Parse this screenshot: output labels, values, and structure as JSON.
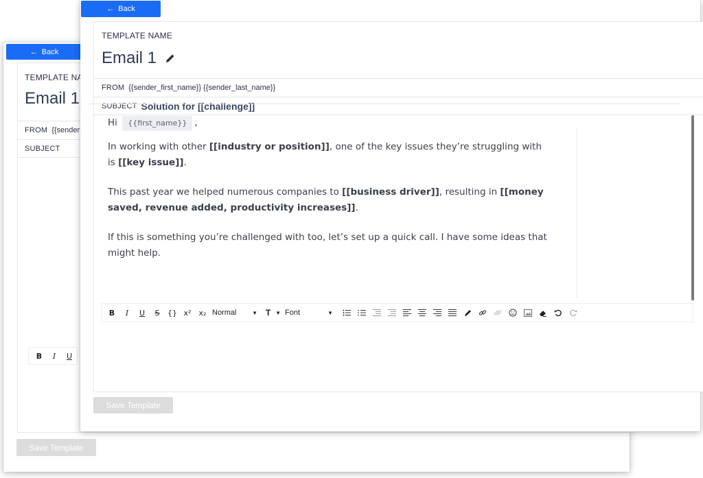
{
  "back_label": "Back",
  "template_name_label": "TEMPLATE NAME",
  "template_name": "Email 1",
  "from_label": "FROM",
  "from_value": "{{sender_first_name}} {{sender_last_name}}",
  "subject_label": "SUBJECT",
  "subject_value": "Solution for [[challenge]]",
  "back_window": {
    "template_name_label": "TEMPLATE NA",
    "template_name": "Email 1",
    "from_value": "{{sender"
  },
  "body": {
    "greeting_hi": "Hi",
    "greeting_token": "{{first_name}}",
    "greeting_comma": ",",
    "p1_a": "In working with other ",
    "p1_b": "[[industry or position]]",
    "p1_c": ", one of the key issues they’re struggling with is ",
    "p1_d": "[[key issue]]",
    "p1_e": ".",
    "p2_a": "This past year we helped numerous companies to ",
    "p2_b": "[[business driver]]",
    "p2_c": ", resulting in ",
    "p2_d": "[[money saved, revenue added, productivity increases]]",
    "p2_e": ".",
    "p3": "If this is something you’re challenged with too, let’s set up a quick call. I have some ideas that might help."
  },
  "toolbar": {
    "bold": "B",
    "italic": "I",
    "underline": "U",
    "strike": "S",
    "code": "{}",
    "superscript": "x²",
    "subscript": "x₂",
    "size_select": "Normal",
    "font_select": "Font",
    "text_size_icon": "T"
  },
  "save_label": "Save Template",
  "colors": {
    "accent": "#1a6cf5",
    "disabled_button": "#dcdcdc",
    "title": "#2e3b55"
  }
}
